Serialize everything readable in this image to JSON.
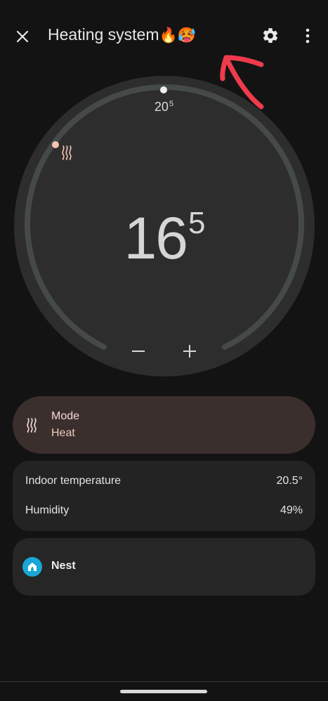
{
  "header": {
    "title": "Heating system",
    "title_emoji": "🔥🥵",
    "close_icon": "close-icon",
    "settings_icon": "gear-icon",
    "more_icon": "more-vert-icon"
  },
  "thermostat": {
    "setpoint_main": "20",
    "setpoint_sup": "5",
    "current_main": "16",
    "current_sup": "5",
    "mode_icon": "heat-icon",
    "minus_label": "−",
    "plus_label": "+"
  },
  "mode_card": {
    "title": "Mode",
    "value": "Heat"
  },
  "info_card": {
    "indoor_label": "Indoor temperature",
    "indoor_value": "20.5°",
    "humidity_label": "Humidity",
    "humidity_value": "49%"
  },
  "nest_card": {
    "label": "Nest",
    "icon": "home-icon"
  },
  "colors": {
    "background": "#131313",
    "dial_face": "#2d2d2d",
    "dial_track": "#454a48",
    "mode_card": "#3b2f2d",
    "heat_accent": "#f5c4b3",
    "nest_icon_bg": "#19a6d6",
    "annotation_arrow": "#ef3b4b"
  }
}
